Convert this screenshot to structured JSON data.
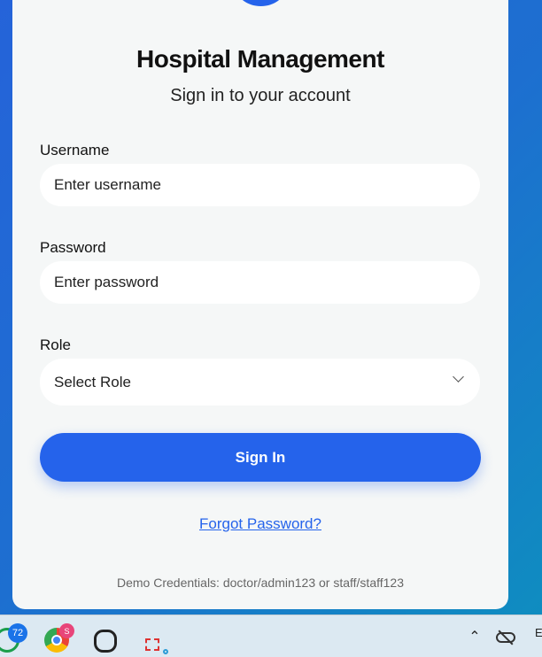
{
  "login": {
    "title": "Hospital Management",
    "subtitle": "Sign in to your account",
    "username_label": "Username",
    "username_placeholder": "Enter username",
    "password_label": "Password",
    "password_placeholder": "Enter password",
    "role_label": "Role",
    "role_value": "Select Role",
    "signin": "Sign In",
    "forgot": "Forgot Password?",
    "demo": "Demo Credentials: doctor/admin123 or staff/staff123"
  },
  "taskbar": {
    "whatsapp_badge": "72",
    "chrome_badge": "S",
    "clipped_text": "E"
  },
  "colors": {
    "accent": "#2563eb"
  }
}
